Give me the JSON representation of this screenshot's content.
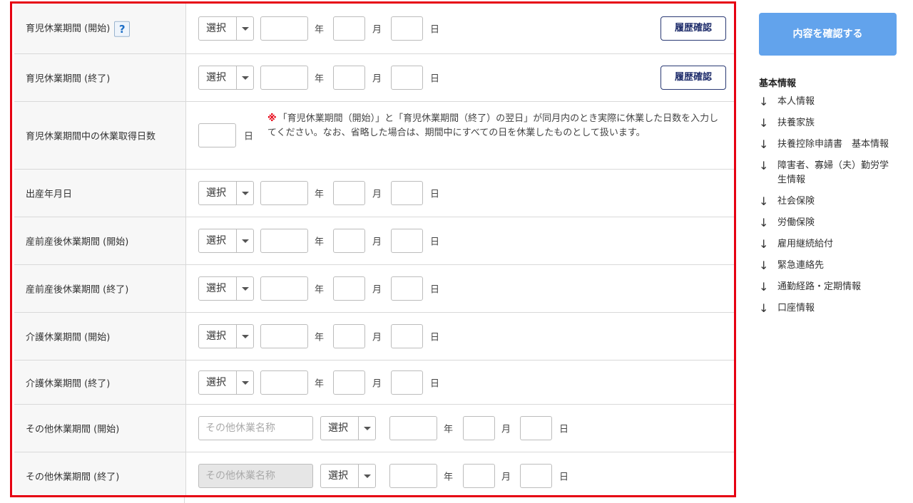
{
  "form": {
    "select_label": "選択",
    "unit_year": "年",
    "unit_month": "月",
    "unit_day": "日",
    "history_button": "履歴確認",
    "help_icon": "?",
    "rows": {
      "childcare_start": "育児休業期間 (開始)",
      "childcare_end": "育児休業期間 (終了)",
      "childcare_days": "育児休業期間中の休業取得日数",
      "birth_date": "出産年月日",
      "maternity_start": "産前産後休業期間 (開始)",
      "maternity_end": "産前産後休業期間 (終了)",
      "nursing_start": "介護休業期間 (開始)",
      "nursing_end": "介護休業期間 (終了)",
      "other_start": "その他休業期間 (開始)",
      "other_end": "その他休業期間 (終了)"
    },
    "other_leave_placeholder": "その他休業名称",
    "note_mark": "※",
    "note_text": "「育児休業期間（開始）」と「育児休業期間（終了）の翌日」が同月内のとき実際に休業した日数を入力してください。なお、省略した場合は、期間中にすべての日を休業したものとして扱います。"
  },
  "sidebar": {
    "confirm_button": "内容を確認する",
    "heading": "基本情報",
    "arrow_icon": "↓",
    "items": [
      "本人情報",
      "扶養家族",
      "扶養控除申請書　基本情報",
      "障害者、寡婦（夫）勤労学生情報",
      "社会保険",
      "労働保険",
      "雇用継続給付",
      "緊急連絡先",
      "通勤経路・定期情報",
      "口座情報"
    ]
  }
}
